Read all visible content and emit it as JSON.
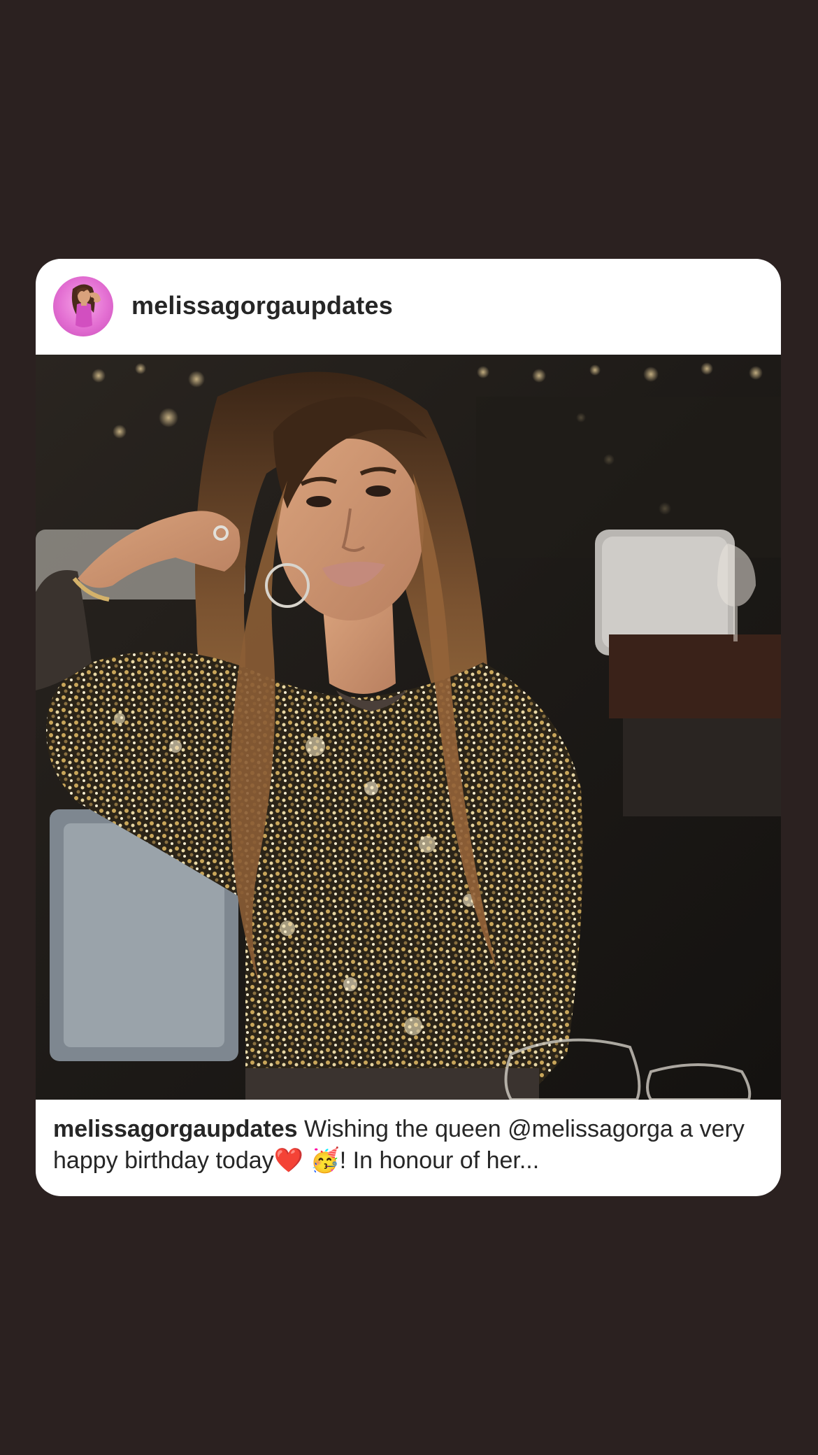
{
  "post": {
    "username": "melissagorgaupdates",
    "avatar_icon": "profile-avatar-cartoon-woman",
    "photo_description": "woman-in-gold-sequin-top-at-restaurant",
    "caption": {
      "username": "melissagorgaupdates",
      "text": "Wishing the queen @melissagorga a very happy birthday today❤️ 🥳! In honour of her..."
    }
  },
  "colors": {
    "background": "#2b2120",
    "card": "#ffffff",
    "text": "#262626",
    "avatar_accent": "#e36fd2"
  }
}
